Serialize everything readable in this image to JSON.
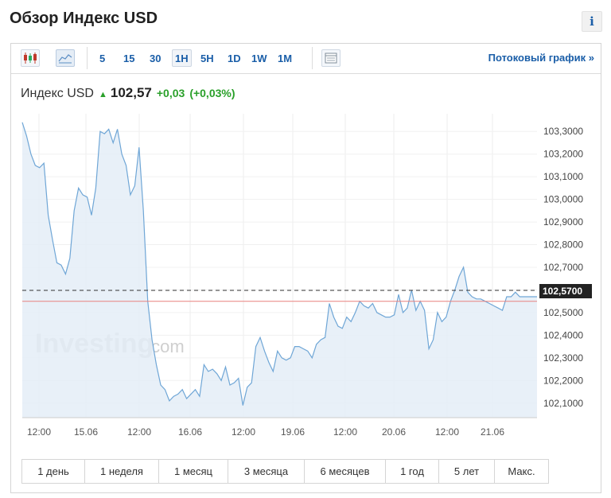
{
  "page": {
    "title": "Обзор Индекс USD",
    "info_label": "i"
  },
  "toolbar": {
    "chart_type_buttons": [
      "candlestick-icon",
      "area-chart-icon"
    ],
    "timeframes": [
      "5",
      "15",
      "30",
      "1H",
      "5H",
      "1D",
      "1W",
      "1M"
    ],
    "active_timeframe": "1H",
    "table_button": "table-icon",
    "stream_link": "Потоковый график »"
  },
  "quote": {
    "name": "Индекс USD",
    "price": "102,57",
    "change": "+0,03",
    "change_pct": "(+0,03%)",
    "direction": "up"
  },
  "watermark": {
    "main": "Investing",
    "suffix": ".com"
  },
  "periods": [
    "1 день",
    "1 неделя",
    "1 месяц",
    "3 месяца",
    "6 месяцев",
    "1 год",
    "5 лет",
    "Макс."
  ],
  "colors": {
    "line": "#6fa6d6",
    "area": "#e4edf7",
    "up": "#2aa02a",
    "link": "#1a5ea8",
    "reference_line": "#e8817f",
    "price_tag_bg": "#222222"
  },
  "chart_data": {
    "type": "area",
    "y_ticks": [
      "103,3000",
      "103,2000",
      "103,1000",
      "103,0000",
      "102,9000",
      "102,8000",
      "102,7000",
      "102,6000",
      "102,5000",
      "102,4000",
      "102,3000",
      "102,2000",
      "102,1000"
    ],
    "ylim": [
      102.05,
      103.35
    ],
    "x_ticks": [
      "12:00",
      "15.06",
      "12:00",
      "16.06",
      "12:00",
      "19.06",
      "12:00",
      "20.06",
      "12:00",
      "21.06"
    ],
    "current_price_label": "102,5700",
    "current_price": 102.57,
    "reference_line": 102.55,
    "grid": true,
    "series": [
      {
        "values": [
          103.34,
          103.28,
          103.2,
          103.15,
          103.14,
          103.16,
          102.93,
          102.82,
          102.72,
          102.71,
          102.67,
          102.74,
          102.95,
          103.05,
          103.02,
          103.01,
          102.93,
          103.05,
          103.3,
          103.29,
          103.31,
          103.25,
          103.31,
          103.2,
          103.15,
          103.02,
          103.06,
          103.23,
          102.95,
          102.55,
          102.38,
          102.27,
          102.18,
          102.16,
          102.11,
          102.13,
          102.14,
          102.16,
          102.12,
          102.14,
          102.16,
          102.13,
          102.27,
          102.24,
          102.25,
          102.23,
          102.2,
          102.26,
          102.18,
          102.19,
          102.21,
          102.09,
          102.17,
          102.19,
          102.35,
          102.39,
          102.33,
          102.28,
          102.24,
          102.33,
          102.3,
          102.29,
          102.3,
          102.35,
          102.35,
          102.34,
          102.33,
          102.3,
          102.36,
          102.38,
          102.39,
          102.54,
          102.48,
          102.44,
          102.43,
          102.48,
          102.46,
          102.5,
          102.55,
          102.53,
          102.52,
          102.54,
          102.5,
          102.49,
          102.48,
          102.48,
          102.49,
          102.58,
          102.5,
          102.52,
          102.6,
          102.51,
          102.55,
          102.51,
          102.34,
          102.38,
          102.5,
          102.46,
          102.48,
          102.55,
          102.6,
          102.66,
          102.7,
          102.59,
          102.57,
          102.56,
          102.56,
          102.55,
          102.54,
          102.53,
          102.52,
          102.51,
          102.57,
          102.57,
          102.59,
          102.57,
          102.57,
          102.57,
          102.57,
          102.57
        ]
      }
    ]
  }
}
